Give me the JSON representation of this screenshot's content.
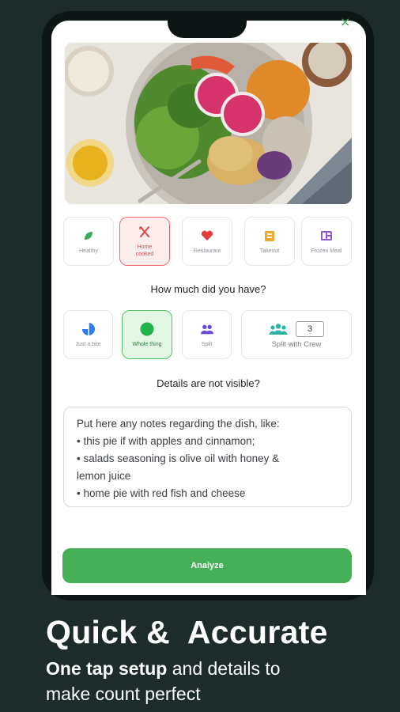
{
  "categories": [
    {
      "label": "Healthy",
      "icon": "leaf-icon",
      "selected": false
    },
    {
      "label": "Home cooked",
      "icon": "fork-knife-icon",
      "selected": true
    },
    {
      "label": "Restaurant",
      "icon": "heart-icon",
      "selected": false
    },
    {
      "label": "Takeout",
      "icon": "takeout-bag-icon",
      "selected": false
    },
    {
      "label": "Frozen Meal",
      "icon": "frozen-meal-icon",
      "selected": false
    }
  ],
  "portion": {
    "question": "How much did you have?",
    "options": [
      {
        "label": "Just a bite",
        "icon": "pie-chart-icon",
        "selected": false
      },
      {
        "label": "Whole thing",
        "icon": "full-circle-icon",
        "selected": true
      },
      {
        "label": "Split",
        "icon": "two-people-icon",
        "selected": false
      }
    ],
    "crew": {
      "label": "Split with Crew",
      "icon": "group-icon",
      "count": "3"
    }
  },
  "details": {
    "question": "Details are not visible?",
    "notes_lines": [
      "Put here any notes regarding the dish, like:",
      "• this pie if with apples and cinnamon;",
      "• salads seasoning is olive oil with honey &",
      "lemon juice",
      "• home pie with red fish and cheese"
    ]
  },
  "analyze_label": "Analyze",
  "close_glyph": "×",
  "promo": {
    "headline": "Quick &  Accurate",
    "sub_bold": "One tap setup",
    "sub_rest_1": " and details to",
    "sub_line_2": "make count perfect"
  },
  "colors": {
    "background": "#1d2b2a",
    "accent_green": "#46b058",
    "selected_red": "#ef6b6b"
  }
}
